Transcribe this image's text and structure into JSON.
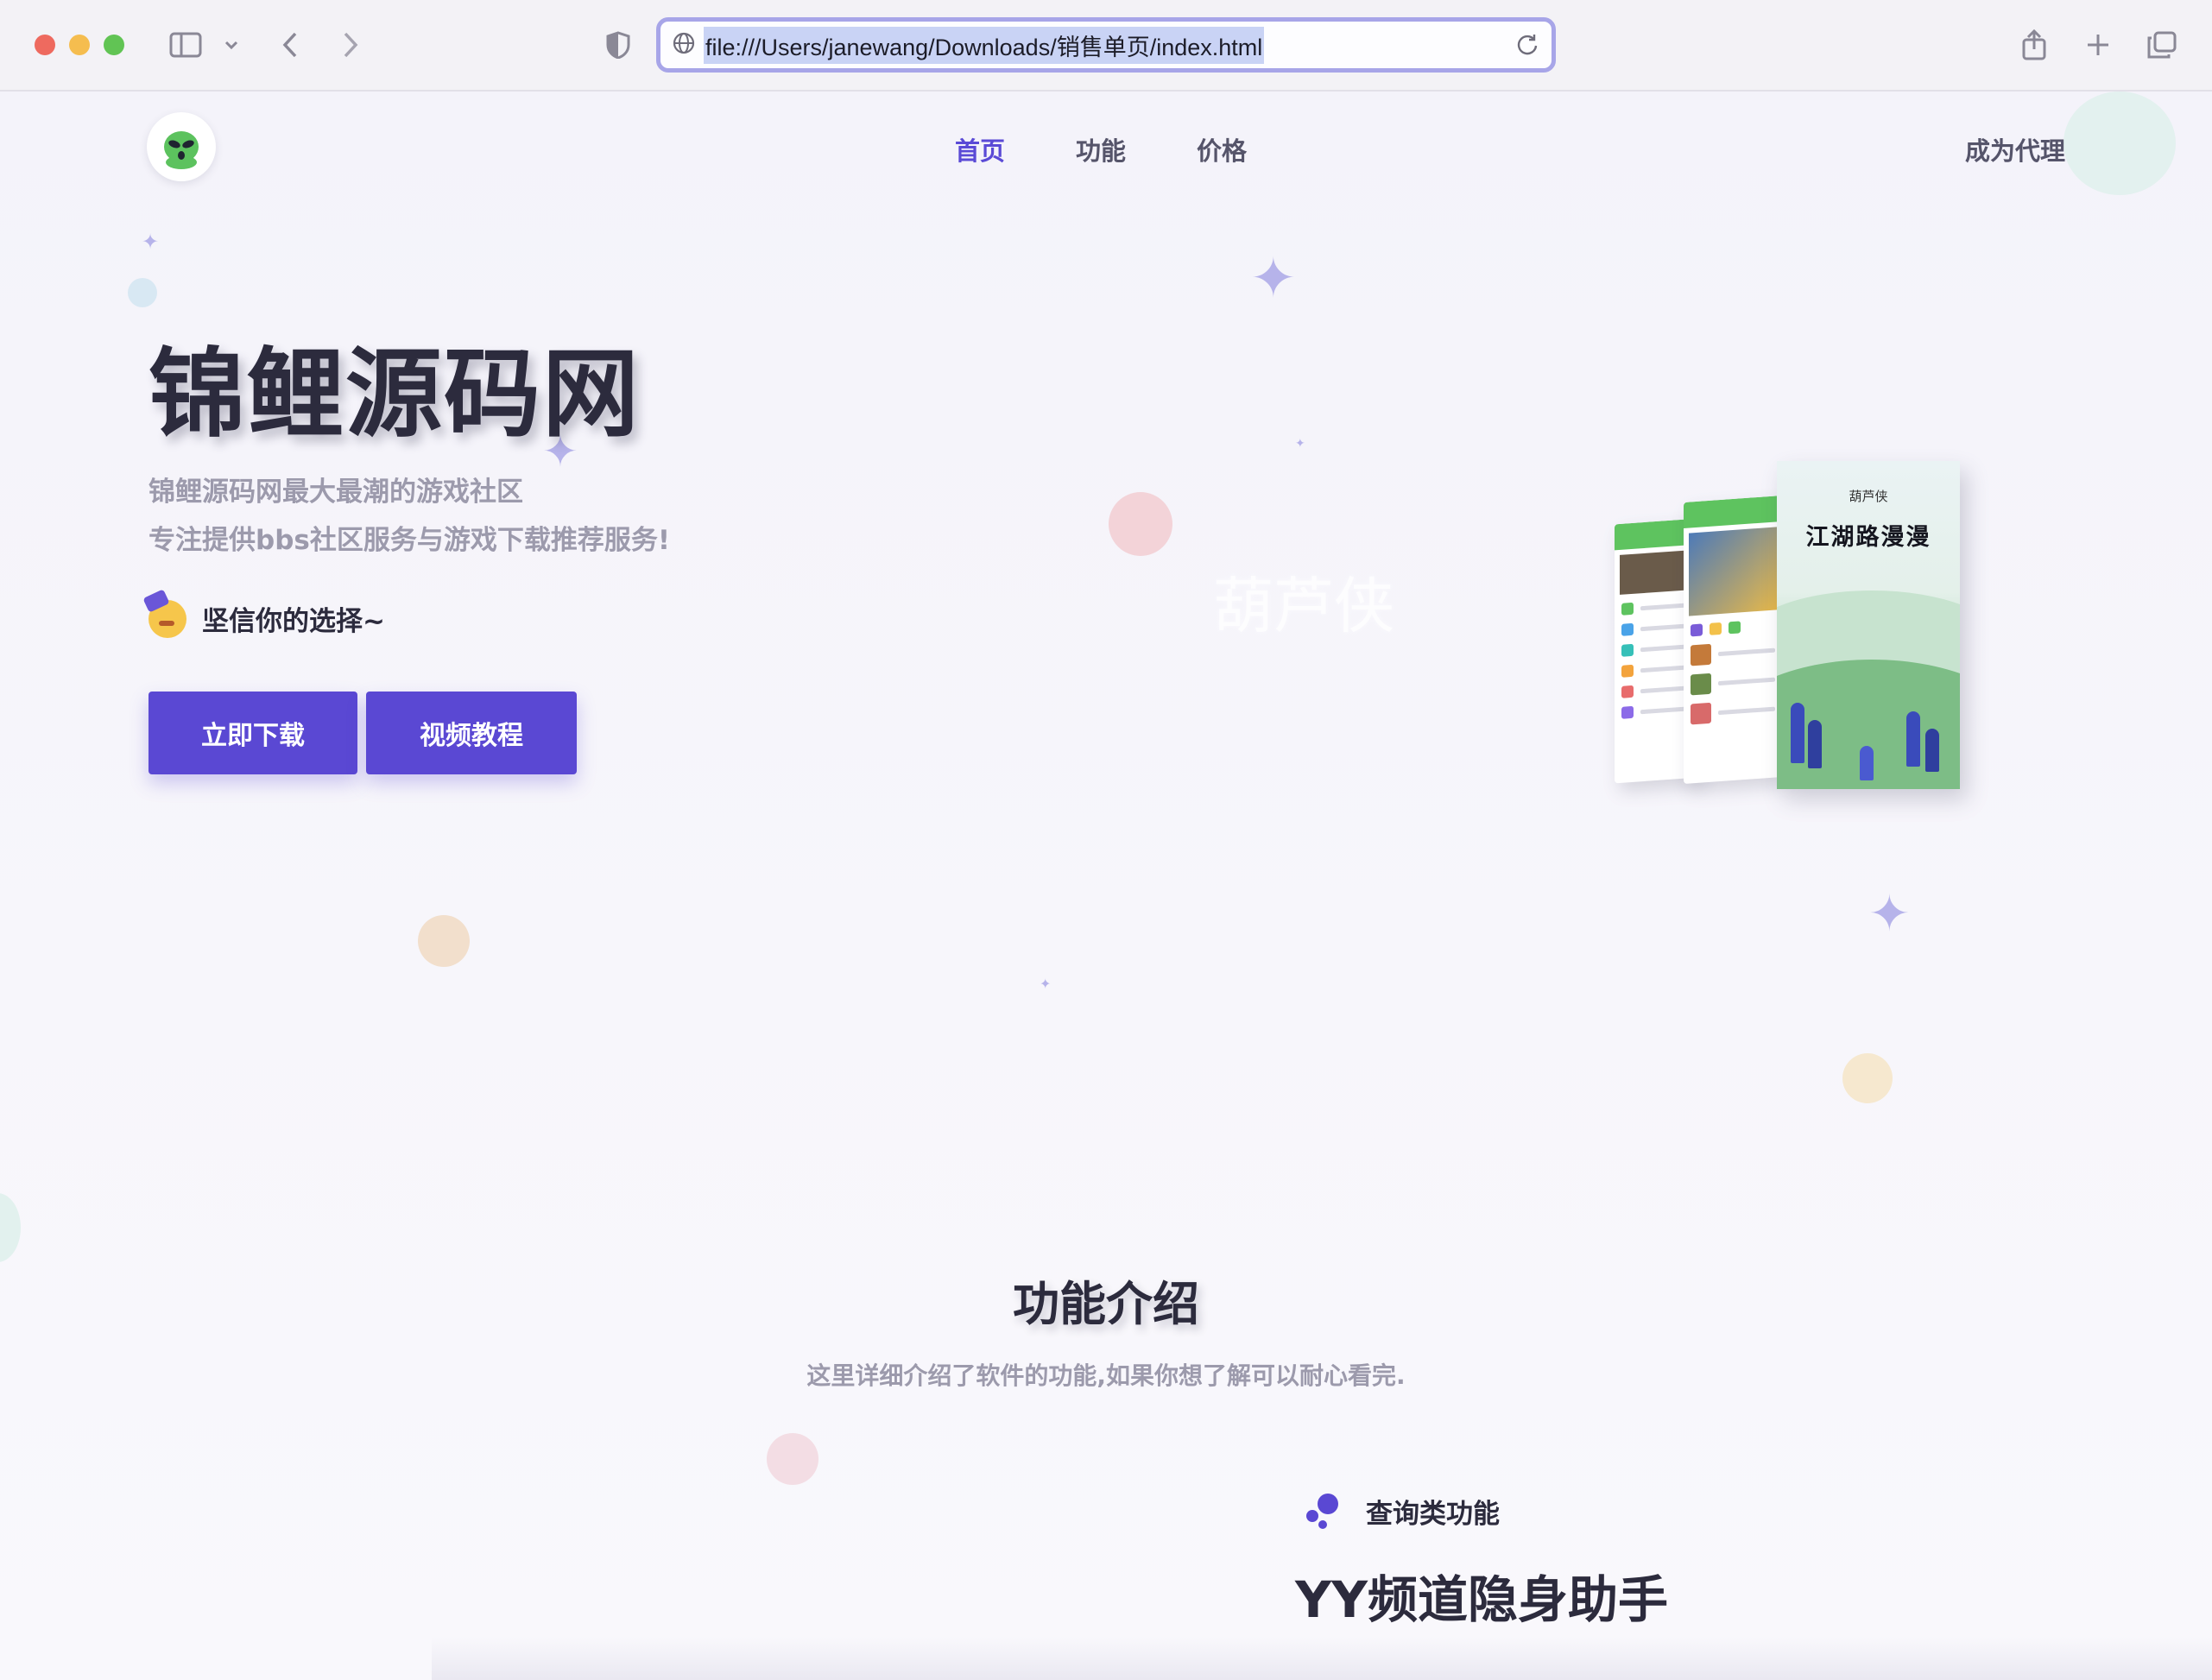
{
  "browser": {
    "url": "file:///Users/janewang/Downloads/销售单页/index.html"
  },
  "nav": {
    "items": [
      "首页",
      "功能",
      "价格"
    ],
    "agent_label": "成为代理"
  },
  "hero": {
    "title": "锦鲤源码网",
    "subtitle_line1": "锦鲤源码网最大最潮的游戏社区",
    "subtitle_line2": "专注提供bbs社区服务与游戏下载推荐服务!",
    "choice_text": "坚信你的选择~",
    "download_button": "立即下载",
    "tutorial_button": "视频教程"
  },
  "mockup": {
    "brand": "葫芦侠",
    "poster_title": "江湖路漫漫",
    "watermark": "葫芦侠"
  },
  "features": {
    "section_title": "功能介绍",
    "section_subtitle": "这里详细介绍了软件的功能,如果你想了解可以耐心看完.",
    "category": "查询类功能",
    "feature_title": "YY频道隐身助手"
  },
  "colors": {
    "accent": "#5a48d3",
    "nav_active": "#5a4ad6",
    "title": "#2c2b3d",
    "subtitle": "#9c9aac"
  }
}
